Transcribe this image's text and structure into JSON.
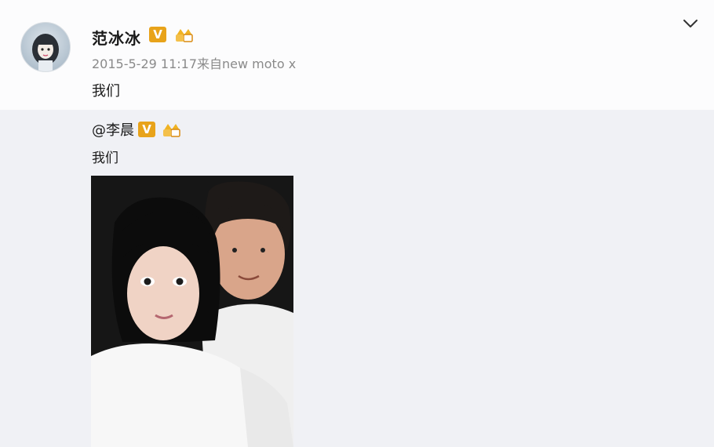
{
  "post": {
    "username": "范冰冰",
    "verified_badge": "V",
    "timestamp": "2015-5-29 11:17",
    "source_prefix": "来自",
    "source": "new moto x",
    "text": "我们"
  },
  "repost": {
    "username": "@李晨",
    "verified_badge": "V",
    "text": "我们"
  },
  "icons": {
    "more": "chevron-down-icon",
    "member": "member-crown-icon"
  },
  "colors": {
    "verified_badge": "#e8a31a",
    "meta_text": "#8a8a8a",
    "background": "#f0f1f5"
  }
}
